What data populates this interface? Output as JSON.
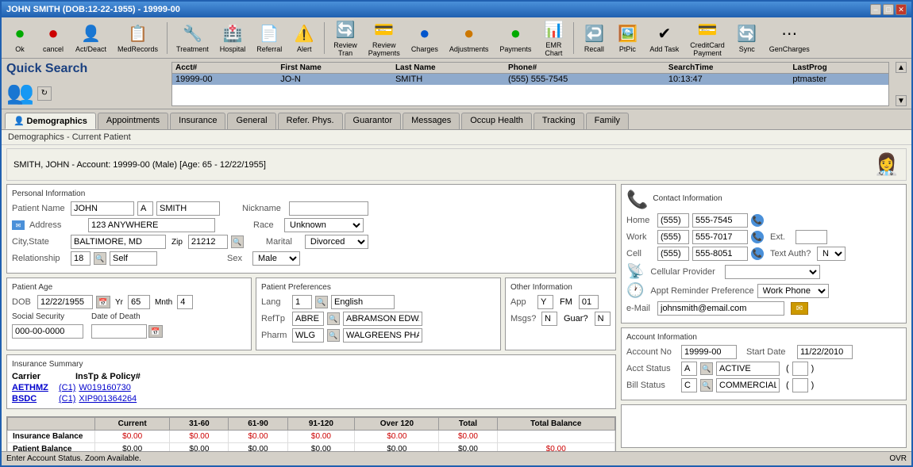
{
  "window": {
    "title": "JOHN SMITH (DOB:12-22-1955) - 19999-00",
    "controls": {
      "min": "–",
      "max": "□",
      "close": "✕"
    }
  },
  "toolbar": {
    "buttons": [
      {
        "id": "ok",
        "label": "Ok",
        "icon": "✅",
        "color": "green"
      },
      {
        "id": "cancel",
        "label": "cancel",
        "icon": "🔴",
        "color": "red"
      },
      {
        "id": "act-deact",
        "label": "Act/Deact",
        "icon": "👤",
        "color": "blue"
      },
      {
        "id": "med-records",
        "label": "MedRecords",
        "icon": "📋",
        "color": "blue"
      },
      {
        "id": "treatment",
        "label": "Treatment",
        "icon": "🔧",
        "color": "gray"
      },
      {
        "id": "hospital",
        "label": "Hospital",
        "icon": "🏥",
        "color": "gray"
      },
      {
        "id": "referral",
        "label": "Referral",
        "icon": "📄",
        "color": "gray"
      },
      {
        "id": "alert",
        "label": "Alert",
        "icon": "⚠️",
        "color": "orange"
      },
      {
        "id": "review-tran",
        "label": "Review Tran",
        "icon": "🔄",
        "color": "blue"
      },
      {
        "id": "review-payments",
        "label": "Review Payments",
        "icon": "💳",
        "color": "blue"
      },
      {
        "id": "charges",
        "label": "Charges",
        "icon": "🔵",
        "color": "blue"
      },
      {
        "id": "adjustments",
        "label": "Adjustments",
        "icon": "🟠",
        "color": "orange"
      },
      {
        "id": "payments",
        "label": "Payments",
        "icon": "🟢",
        "color": "green"
      },
      {
        "id": "emr-chart",
        "label": "EMR Chart",
        "icon": "📊",
        "color": "green"
      },
      {
        "id": "recall",
        "label": "Recall",
        "icon": "↩️",
        "color": "gray"
      },
      {
        "id": "ptpic",
        "label": "PtPic",
        "icon": "🖼️",
        "color": "gray"
      },
      {
        "id": "add-task",
        "label": "Add Task",
        "icon": "✓",
        "color": "gray"
      },
      {
        "id": "credit-card",
        "label": "CreditCard Payment",
        "icon": "💳",
        "color": "gray"
      },
      {
        "id": "sync",
        "label": "Sync",
        "icon": "🔄",
        "color": "gray"
      },
      {
        "id": "gen-charges",
        "label": "GenCharges",
        "icon": "⋯",
        "color": "gray"
      }
    ]
  },
  "quick_search": {
    "title": "Quick Search",
    "table": {
      "columns": [
        "Acct#",
        "First Name",
        "Last Name",
        "Phone#",
        "SearchTime",
        "LastProg"
      ],
      "rows": [
        {
          "acct": "19999-00",
          "first": "JO-N",
          "last": "SMITH",
          "phone": "(555) 555-7545",
          "search_time": "10:13:47",
          "last_prog": "ptmaster"
        }
      ]
    }
  },
  "tabs": [
    {
      "id": "demographics",
      "label": "Demographics",
      "active": true,
      "icon": "👤"
    },
    {
      "id": "appointments",
      "label": "Appointments",
      "active": false
    },
    {
      "id": "insurance",
      "label": "Insurance",
      "active": false
    },
    {
      "id": "general",
      "label": "General",
      "active": false
    },
    {
      "id": "refer-phys",
      "label": "Refer. Phys.",
      "active": false
    },
    {
      "id": "guarantor",
      "label": "Guarantor",
      "active": false
    },
    {
      "id": "messages",
      "label": "Messages",
      "active": false
    },
    {
      "id": "occup-health",
      "label": "Occup Health",
      "active": false
    },
    {
      "id": "tracking",
      "label": "Tracking",
      "active": false
    },
    {
      "id": "family",
      "label": "Family",
      "active": false
    }
  ],
  "demographics": {
    "section_title": "Demographics - Current Patient",
    "patient_header": "SMITH, JOHN - Account: 19999-00 (Male) [Age: 65 - 12/22/1955]",
    "personal_info": {
      "title": "Personal Information",
      "patient_name_label": "Patient Name",
      "first_name": "JOHN",
      "middle": "A",
      "last_name": "SMITH",
      "nickname_label": "Nickname",
      "nickname": "",
      "address_label": "Address",
      "address": "123 ANYWHERE",
      "race_label": "Race",
      "race": "Unknown",
      "city_state_label": "City,State",
      "city_state": "BALTIMORE, MD",
      "zip_label": "Zip",
      "zip": "21212",
      "marital_label": "Marital",
      "marital": "Divorced",
      "relationship_label": "Relationship",
      "relationship": "18",
      "relationship_val": "Self",
      "sex_label": "Sex",
      "sex": "Male"
    },
    "patient_age": {
      "title": "Patient Age",
      "dob_label": "DOB",
      "dob": "12/22/1955",
      "yr_label": "Yr",
      "yr": "65",
      "mnth_label": "Mnth",
      "mnth": "4",
      "ss_label": "Social Security",
      "ss": "000-00-0000",
      "dod_label": "Date of Death",
      "dod": ""
    },
    "insurance_summary": {
      "title": "Insurance Summary",
      "col_carrier": "Carrier",
      "col_instp": "InsTp & Policy#",
      "rows": [
        {
          "carrier": "AETHMZ",
          "instp": "(C1)",
          "policy": "W019160730"
        },
        {
          "carrier": "BSDC",
          "instp": "(C1)",
          "policy": "XIP901364264"
        }
      ]
    },
    "patient_preferences": {
      "title": "Patient Preferences",
      "lang_label": "Lang",
      "lang_code": "1",
      "lang_val": "English",
      "reftp_label": "RefTp",
      "reftp_code": "ABRE",
      "reftp_val": "ABRAMSON EDWAR",
      "pharm_label": "Pharm",
      "pharm_code": "WLG",
      "pharm_val": "WALGREENS PHARI"
    },
    "other_info": {
      "title": "Other Information",
      "app_label": "App",
      "app": "Y",
      "fm_label": "FM",
      "fm": "01",
      "msgs_label": "Msgs?",
      "msgs": "N",
      "guar_label": "Guar?",
      "guar": "N"
    },
    "contact_info": {
      "title": "Contact Information",
      "home_label": "Home",
      "home_area": "(555)",
      "home_num": "555-7545",
      "work_label": "Work",
      "work_area": "(555)",
      "work_num": "555-7017",
      "ext_label": "Ext.",
      "ext": "",
      "cell_label": "Cell",
      "cell_area": "(555)",
      "cell_num": "555-8051",
      "text_auth_label": "Text Auth?",
      "text_auth": "N",
      "cellular_label": "Cellular Provider",
      "cellular": "",
      "appt_reminder_label": "Appt Reminder Preference",
      "appt_reminder": "Work Phone",
      "email_label": "e-Mail",
      "email": "johnsmith@email.com"
    },
    "account_info": {
      "title": "Account Information",
      "acct_no_label": "Account No",
      "acct_no": "19999-00",
      "start_date_label": "Start Date",
      "start_date": "11/22/2010",
      "acct_status_label": "Acct Status",
      "acct_status_code": "A",
      "acct_status_val": "ACTIVE",
      "bill_status_label": "Bill Status",
      "bill_status_code": "C",
      "bill_status_val": "COMMERCIAL"
    },
    "balance": {
      "columns": [
        "",
        "Current",
        "31-60",
        "61-90",
        "91-120",
        "Over 120",
        "Total",
        "Total Balance"
      ],
      "rows": [
        {
          "label": "Insurance Balance",
          "current": "$0.00",
          "d31": "$0.00",
          "d61": "$0.00",
          "d91": "$0.00",
          "over": "$0.00",
          "total": "$0.00",
          "total_bal": ""
        },
        {
          "label": "Patient Balance",
          "current": "$0.00",
          "d31": "$0.00",
          "d61": "$0.00",
          "d91": "$0.00",
          "over": "$0.00",
          "total": "$0.00",
          "total_bal": "$0.00"
        }
      ]
    }
  },
  "status_bar": {
    "text": "Enter Account Status. Zoom Available.",
    "ovr": "OVR"
  }
}
